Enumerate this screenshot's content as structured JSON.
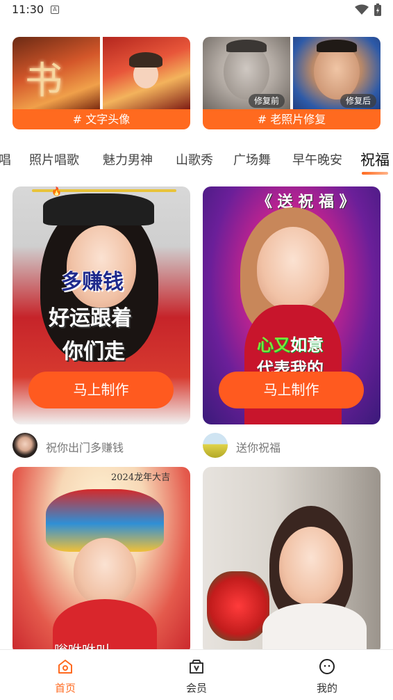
{
  "status_bar": {
    "time": "11:30",
    "notification_icon": "a-box-icon",
    "wifi_icon": "wifi-icon",
    "battery_icon": "battery-charging-icon"
  },
  "features": [
    {
      "label": "# 文字头像"
    },
    {
      "label": "# 老照片修复",
      "before_tag": "修复前",
      "after_tag": "修复后"
    }
  ],
  "category_tabs": [
    {
      "label": "唱"
    },
    {
      "label": "照片唱歌"
    },
    {
      "label": "魅力男神"
    },
    {
      "label": "山歌秀"
    },
    {
      "label": "广场舞"
    },
    {
      "label": "早午晚安"
    },
    {
      "label": "祝福",
      "active": true
    }
  ],
  "cards": [
    {
      "lyrics": [
        "多赚钱",
        "好运跟着",
        "你们走"
      ],
      "button": "马上制作",
      "author_name": "祝你出门多赚钱"
    },
    {
      "lyrics": [
        "《 送 祝 福 》",
        "心又如意",
        "代表我的"
      ],
      "button": "马上制作",
      "author_name": "送你祝福"
    },
    {
      "year_text": "2024龙年大吉",
      "lyric": "嗡咻咻叫"
    },
    {}
  ],
  "bottom_nav": [
    {
      "label": "首页",
      "icon": "home-icon",
      "active": true
    },
    {
      "label": "会员",
      "icon": "vip-bag-icon"
    },
    {
      "label": "我的",
      "icon": "profile-smile-icon"
    }
  ],
  "colors": {
    "accent": "#ff6a1f",
    "button": "#ff5a1f"
  }
}
